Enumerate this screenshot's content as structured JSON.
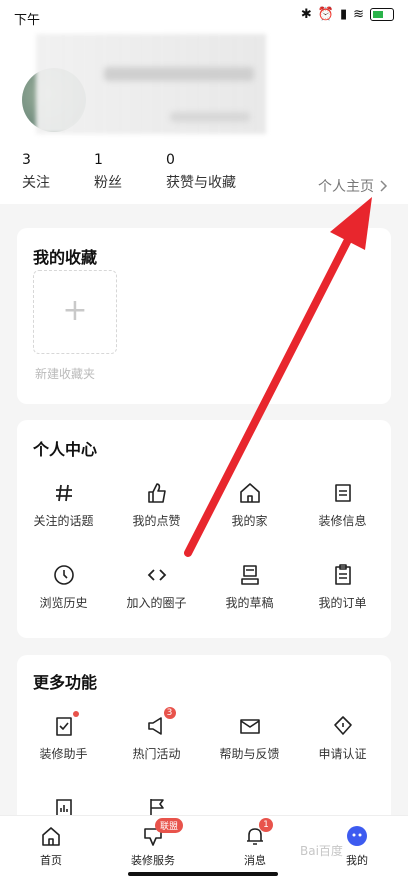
{
  "status_bar": {
    "time": "下午",
    "icons": [
      "bluetooth-icon",
      "alarm-icon",
      "signal-icon",
      "wifi-icon",
      "battery-icon"
    ]
  },
  "profile": {
    "stats": [
      {
        "value": "3",
        "label": "关注"
      },
      {
        "value": "1",
        "label": "粉丝"
      },
      {
        "value": "0",
        "label": "获赞与收藏"
      }
    ],
    "homepage_link": "个人主页"
  },
  "favorites": {
    "title": "我的收藏",
    "new_folder_label": "新建收藏夹"
  },
  "personal_center": {
    "title": "个人中心",
    "items": [
      {
        "label": "关注的话题",
        "icon": "hashtag-icon"
      },
      {
        "label": "我的点赞",
        "icon": "thumbs-up-icon"
      },
      {
        "label": "我的家",
        "icon": "home-icon"
      },
      {
        "label": "装修信息",
        "icon": "info-card-icon"
      },
      {
        "label": "浏览历史",
        "icon": "clock-icon"
      },
      {
        "label": "加入的圈子",
        "icon": "code-icon"
      },
      {
        "label": "我的草稿",
        "icon": "draft-icon"
      },
      {
        "label": "我的订单",
        "icon": "order-icon"
      }
    ]
  },
  "more_functions": {
    "title": "更多功能",
    "items": [
      {
        "label": "装修助手",
        "icon": "assistant-icon"
      },
      {
        "label": "热门活动",
        "icon": "megaphone-icon",
        "badge": "3"
      },
      {
        "label": "帮助与反馈",
        "icon": "mail-icon"
      },
      {
        "label": "申请认证",
        "icon": "badge-icon"
      }
    ]
  },
  "tabbar": {
    "tabs": [
      {
        "label": "首页",
        "icon": "home-icon"
      },
      {
        "label": "装修服务",
        "icon": "service-icon",
        "badge": "联盟"
      },
      {
        "label": "消息",
        "icon": "bell-icon",
        "badge": "1"
      },
      {
        "label": "我的",
        "icon": "profile-icon"
      }
    ]
  },
  "watermark": "Bai百度",
  "colors": {
    "accent_red": "#e8534b",
    "arrow_red": "#e8262d",
    "profile_blue": "#3d5bf0"
  }
}
